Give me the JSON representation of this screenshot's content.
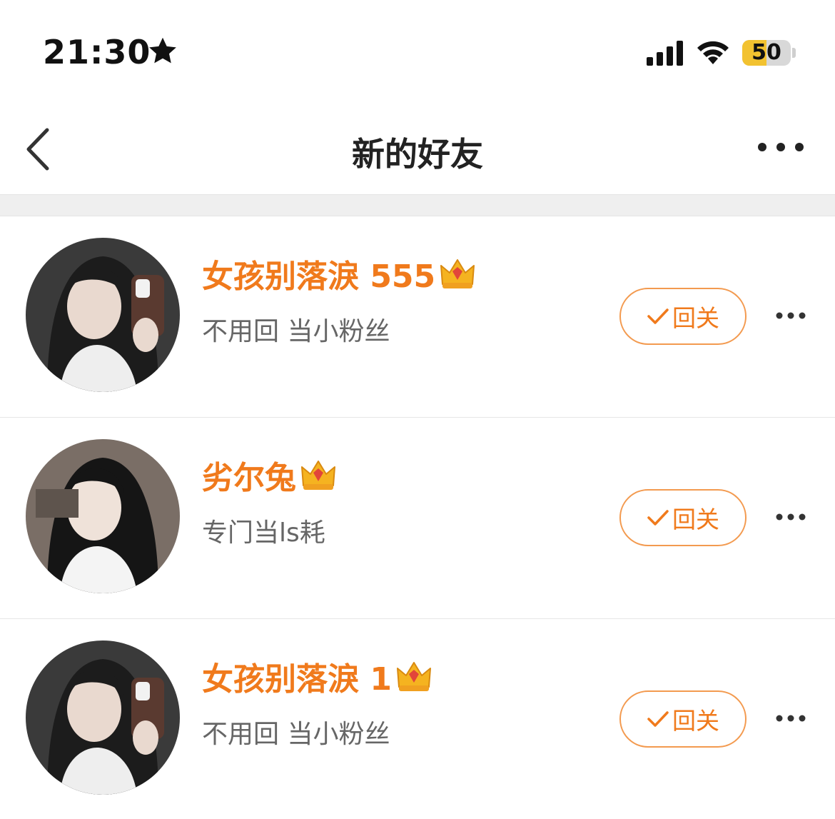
{
  "status_bar": {
    "time": "21:30",
    "battery_level": "50",
    "battery_fraction": 0.5,
    "icons": [
      "star-icon",
      "signal-icon",
      "wifi-icon",
      "battery-icon"
    ]
  },
  "nav": {
    "title": "新的好友",
    "back_icon": "chevron-left-icon",
    "more_icon": "more-horizontal-icon"
  },
  "colors": {
    "accent": "#f07a1c",
    "button_border": "#f39a4f",
    "battery": "#f2c230",
    "divider": "#e6e6e6"
  },
  "friends": [
    {
      "name": "女孩别落淚 555",
      "bio": "不用回 当小粉丝",
      "badge": "vip-crown-icon",
      "badge_level": "1",
      "button_label": "回关"
    },
    {
      "name": "劣尔兔",
      "bio": "专门当ls耗",
      "badge": "vip-crown-icon",
      "badge_level": "2",
      "button_label": "回关"
    },
    {
      "name": "女孩别落淚 1",
      "bio": "不用回 当小粉丝",
      "badge": "vip-crown-icon",
      "badge_level": "1",
      "button_label": "回关"
    }
  ]
}
